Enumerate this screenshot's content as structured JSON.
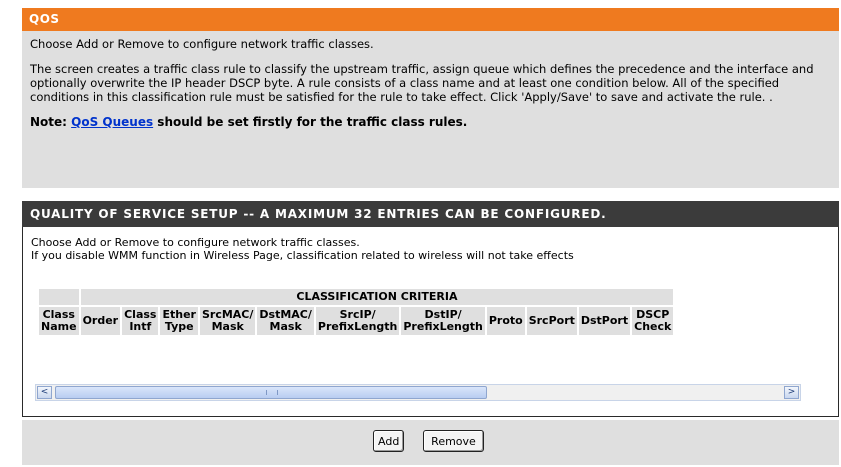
{
  "qos": {
    "title": "QOS",
    "intro": "Choose Add or Remove to configure network traffic classes.",
    "description": "The screen creates a traffic class rule to classify the upstream traffic, assign queue which defines the precedence and the interface and optionally overwrite the IP header DSCP byte. A rule consists of a class name and at least one condition below. All of the specified conditions in this classification rule must be satisfied for the rule to take effect. Click 'Apply/Save' to save and activate the rule. .",
    "note_prefix": "Note: ",
    "note_link": "QoS Queues",
    "note_suffix": " should be set firstly for the traffic class rules."
  },
  "setup": {
    "title": "QUALITY OF SERVICE SETUP -- A MAXIMUM 32 ENTRIES CAN BE CONFIGURED.",
    "line1": "Choose Add or Remove to configure network traffic classes.",
    "line2": "If you disable WMM function in Wireless Page, classification related to wireless will not take effects",
    "criteria_header": "CLASSIFICATION CRITERIA",
    "columns": [
      {
        "l1": "Class",
        "l2": "Name"
      },
      {
        "l1": "Order",
        "l2": ""
      },
      {
        "l1": "Class",
        "l2": "Intf"
      },
      {
        "l1": "Ether",
        "l2": "Type"
      },
      {
        "l1": "SrcMAC/",
        "l2": "Mask"
      },
      {
        "l1": "DstMAC/",
        "l2": "Mask"
      },
      {
        "l1": "SrcIP/",
        "l2": "PrefixLength"
      },
      {
        "l1": "DstIP/",
        "l2": "PrefixLength"
      },
      {
        "l1": "Proto",
        "l2": ""
      },
      {
        "l1": "SrcPort",
        "l2": ""
      },
      {
        "l1": "DstPort",
        "l2": ""
      },
      {
        "l1": "DSCP",
        "l2": "Check"
      }
    ]
  },
  "scrollbar": {
    "left_arrow": "<",
    "right_arrow": ">"
  },
  "buttons": {
    "add": "Add",
    "remove": "Remove"
  }
}
